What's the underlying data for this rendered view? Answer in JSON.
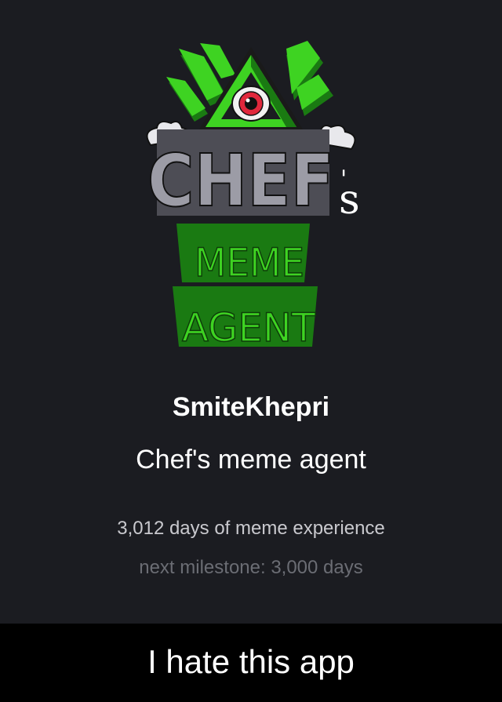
{
  "profile": {
    "username": "SmiteKhepri",
    "role": "Chef's meme agent",
    "experience": "3,012 days of meme experience",
    "milestone": "next milestone: 3,000 days"
  },
  "logo": {
    "icon": "chefs-meme-agent-logo",
    "lines": [
      "CHEF",
      "'s",
      "MEME",
      "AGENT"
    ],
    "colors": {
      "green_bright": "#3ed322",
      "green_dark": "#1a7a12",
      "stone": "#9c9ca6",
      "eye_red": "#e0283c"
    }
  },
  "meme": {
    "caption": "I hate this app"
  },
  "theme": {
    "background": "#1b1c21",
    "caption_background": "#000000",
    "text_primary": "#ffffff",
    "text_secondary": "#c9c9ce",
    "text_muted": "#6b6d74"
  }
}
